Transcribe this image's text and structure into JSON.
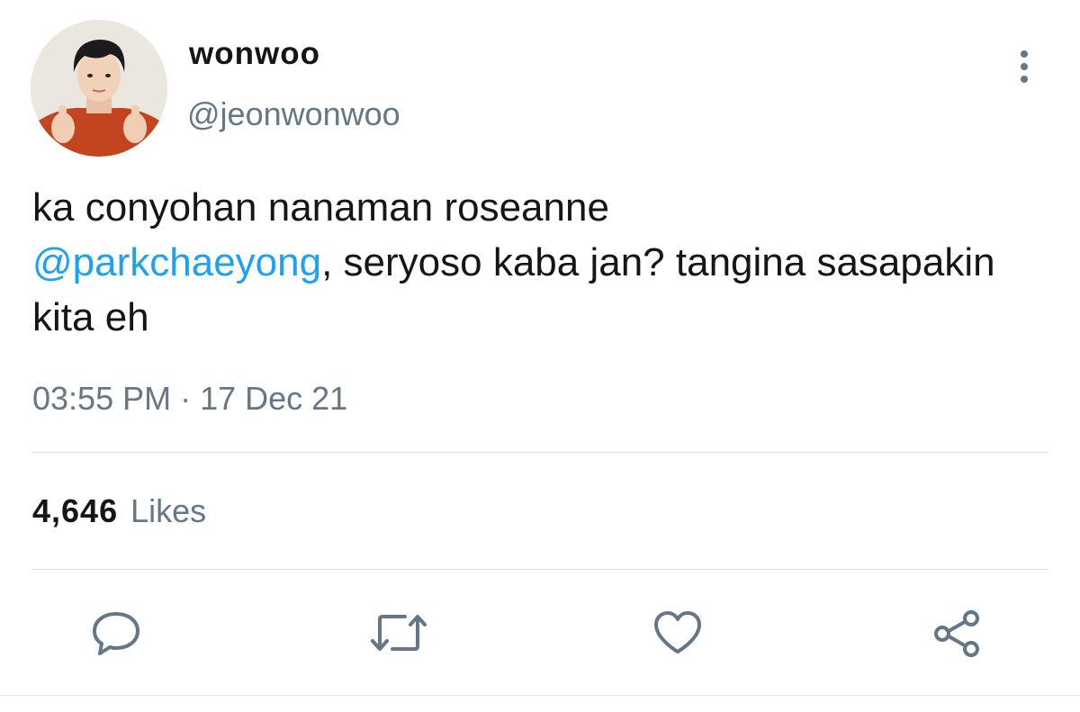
{
  "tweet": {
    "author": {
      "display_name": "wonwoo",
      "handle": "@jeonwonwoo",
      "avatar_icon": "profile-photo"
    },
    "text_before": "ka conyohan nanaman roseanne",
    "mention": "@parkchaeyong",
    "text_after": ", seryoso kaba jan? tangina sasapakin kita eh",
    "timestamp": "03:55 PM · 17 Dec 21",
    "likes": {
      "count": "4,646",
      "label": "Likes"
    }
  },
  "actions": [
    {
      "icon": "reply-icon"
    },
    {
      "icon": "retweet-icon"
    },
    {
      "icon": "like-icon"
    },
    {
      "icon": "share-icon"
    }
  ],
  "colors": {
    "link": "#1da1f2",
    "secondary_text": "#657786",
    "primary_text": "#14171a",
    "divider": "#d6dde2"
  }
}
